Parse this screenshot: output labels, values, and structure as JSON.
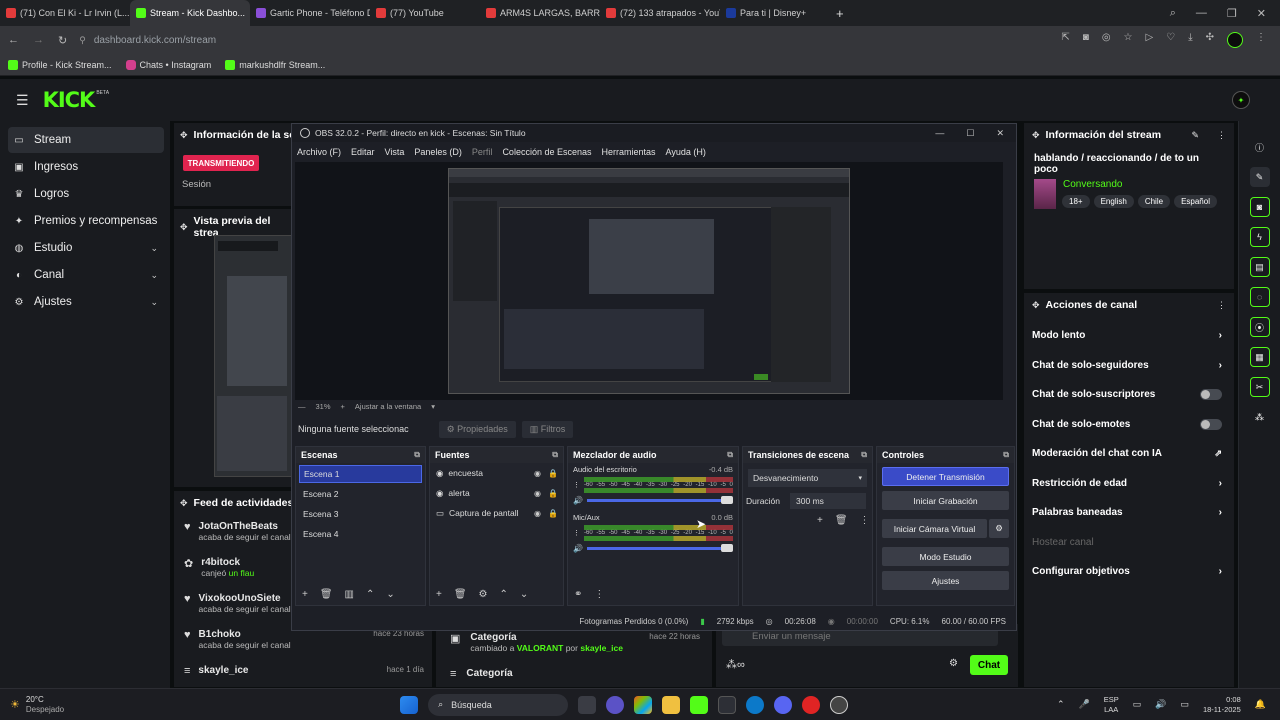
{
  "browser": {
    "tabs": [
      {
        "label": "(71) Con El Ki - Lr Irvin (L...",
        "color": "#e23b3b"
      },
      {
        "label": "Stream - Kick Dashbo...",
        "color": "#53fc18",
        "active": true
      },
      {
        "label": "Gartic Phone - Teléfono D...",
        "color": "#8a4fd8"
      },
      {
        "label": "(77) YouTube",
        "color": "#e23b3b"
      },
      {
        "label": "ARM4S LARGAS, BARRAS...",
        "color": "#e23b3b"
      },
      {
        "label": "(72) 133 atrapados - YouTu...",
        "color": "#e23b3b"
      },
      {
        "label": "Para ti | Disney+",
        "color": "#1b3a9c"
      }
    ],
    "new_tab": "+",
    "url": "dashboard.kick.com/stream",
    "bookmarks": [
      "Profile - Kick Stream...",
      "Chats • Instagram",
      "markushdlfr Stream..."
    ]
  },
  "kick": {
    "logo": "KICK",
    "logo_badge": "BETA",
    "sidebar": [
      {
        "label": "Stream",
        "icon": "▭",
        "active": true
      },
      {
        "label": "Ingresos",
        "icon": "▣"
      },
      {
        "label": "Logros",
        "icon": "♛"
      },
      {
        "label": "Premios y recompensas",
        "icon": "✦"
      },
      {
        "label": "Estudio",
        "icon": "◍",
        "chevron": "⌄"
      },
      {
        "label": "Canal",
        "icon": "◐",
        "chevron": "⌄"
      },
      {
        "label": "Ajustes",
        "icon": "⚙",
        "chevron": "⌄"
      }
    ],
    "session_panel": {
      "title": "Información de la ses",
      "badge": "TRANSMITIENDO",
      "label": "Sesión"
    },
    "preview_panel": {
      "title": "Vista previa del strea"
    },
    "feed": {
      "title": "Feed de actividades",
      "items": [
        {
          "user": "JotaOnTheBeats",
          "text": "acaba de seguir el canal",
          "time": ""
        },
        {
          "user": "r4bitock",
          "text_pre": "canjeó",
          "text_hl": "un flau",
          "time": ""
        },
        {
          "user": "VixokooUnoSiete",
          "text": "acaba de seguir el canal",
          "time": ""
        },
        {
          "user": "B1choko",
          "text": "acaba de seguir el canal",
          "time": "hace 23 horas"
        },
        {
          "user": "skayle_ice",
          "text": "",
          "time": "hace 1 día"
        }
      ]
    },
    "category_feed": [
      {
        "title": "Categoría",
        "pre": "cambiado a",
        "hl": "VALORANT",
        "mid": "por",
        "user": "skayle_ice",
        "time": "hace 22 horas"
      },
      {
        "title": "Categoría"
      }
    ],
    "chat": {
      "placeholder": "Enviar un mensaje",
      "send": "Chat"
    },
    "stream_info": {
      "title": "Información del stream",
      "stream_title": "hablando / reaccionando / de to un poco",
      "category": "Conversando",
      "tags": [
        "18+",
        "English",
        "Chile",
        "Español"
      ]
    },
    "channel_actions": {
      "title": "Acciones de canal",
      "items": [
        {
          "label": "Modo lento",
          "control": "chevron"
        },
        {
          "label": "Chat de solo-seguidores",
          "control": "chevron"
        },
        {
          "label": "Chat de solo-suscriptores",
          "control": "toggle"
        },
        {
          "label": "Chat de solo-emotes",
          "control": "toggle"
        },
        {
          "label": "Moderación del chat con IA",
          "control": "external"
        },
        {
          "label": "Restricción de edad",
          "control": "chevron"
        },
        {
          "label": "Palabras baneadas",
          "control": "chevron"
        },
        {
          "label": "Hostear canal",
          "control": "none",
          "disabled": true
        },
        {
          "label": "Configurar objetivos",
          "control": "chevron"
        }
      ]
    }
  },
  "obs": {
    "title": "OBS 32.0.2 - Perfil: directo en kick - Escenas: Sin Título",
    "menu": [
      "Archivo (F)",
      "Editar",
      "Vista",
      "Paneles (D)",
      "Perfil",
      "Colección de Escenas",
      "Herramientas",
      "Ayuda (H)"
    ],
    "zoom": "31%",
    "fit": "Ajustar a la ventana",
    "no_source": "Ninguna fuente seleccionac",
    "properties": "Propiedades",
    "filters": "Filtros",
    "scenes": {
      "title": "Escenas",
      "items": [
        "Escena 1",
        "Escena 2",
        "Escena 3",
        "Escena 4"
      ],
      "selected": 0
    },
    "sources": {
      "title": "Fuentes",
      "items": [
        {
          "label": "encuesta",
          "icon": "◉"
        },
        {
          "label": "alerta",
          "icon": "◉"
        },
        {
          "label": "Captura de pantall",
          "icon": "▭"
        }
      ]
    },
    "mixer": {
      "title": "Mezclador de audio",
      "channels": [
        {
          "name": "Audio del escritorio",
          "db": "-0.4 dB"
        },
        {
          "name": "Mic/Aux",
          "db": "0.0 dB"
        }
      ],
      "scale": [
        "-60",
        "-55",
        "-50",
        "-45",
        "-40",
        "-35",
        "-30",
        "-25",
        "-20",
        "-15",
        "-10",
        "-5",
        "0"
      ]
    },
    "transitions": {
      "title": "Transiciones de escena",
      "type": "Desvanecimiento",
      "duration_label": "Duración",
      "duration": "300 ms"
    },
    "controls": {
      "title": "Controles",
      "buttons": [
        "Detener Transmisión",
        "Iniciar Grabación",
        "Iniciar Cámara Virtual",
        "Modo Estudio",
        "Ajustes"
      ]
    },
    "status": {
      "dropped": "Fotogramas Perdidos 0 (0.0%)",
      "kbps": "2792 kbps",
      "time_live": "00:26:08",
      "time_rec": "00:00:00",
      "cpu": "CPU: 6.1%",
      "fps": "60.00 / 60.00 FPS"
    }
  },
  "taskbar": {
    "weather_temp": "20°C",
    "weather_desc": "Despejado",
    "search": "Búsqueda",
    "lang": "ESP",
    "lang2": "LAA",
    "time": "0:08",
    "date": "18-11-2025"
  },
  "colors": {
    "kick_green": "#53fc18",
    "obs_blue": "#3a4bc8",
    "live_red": "#e0244f"
  }
}
